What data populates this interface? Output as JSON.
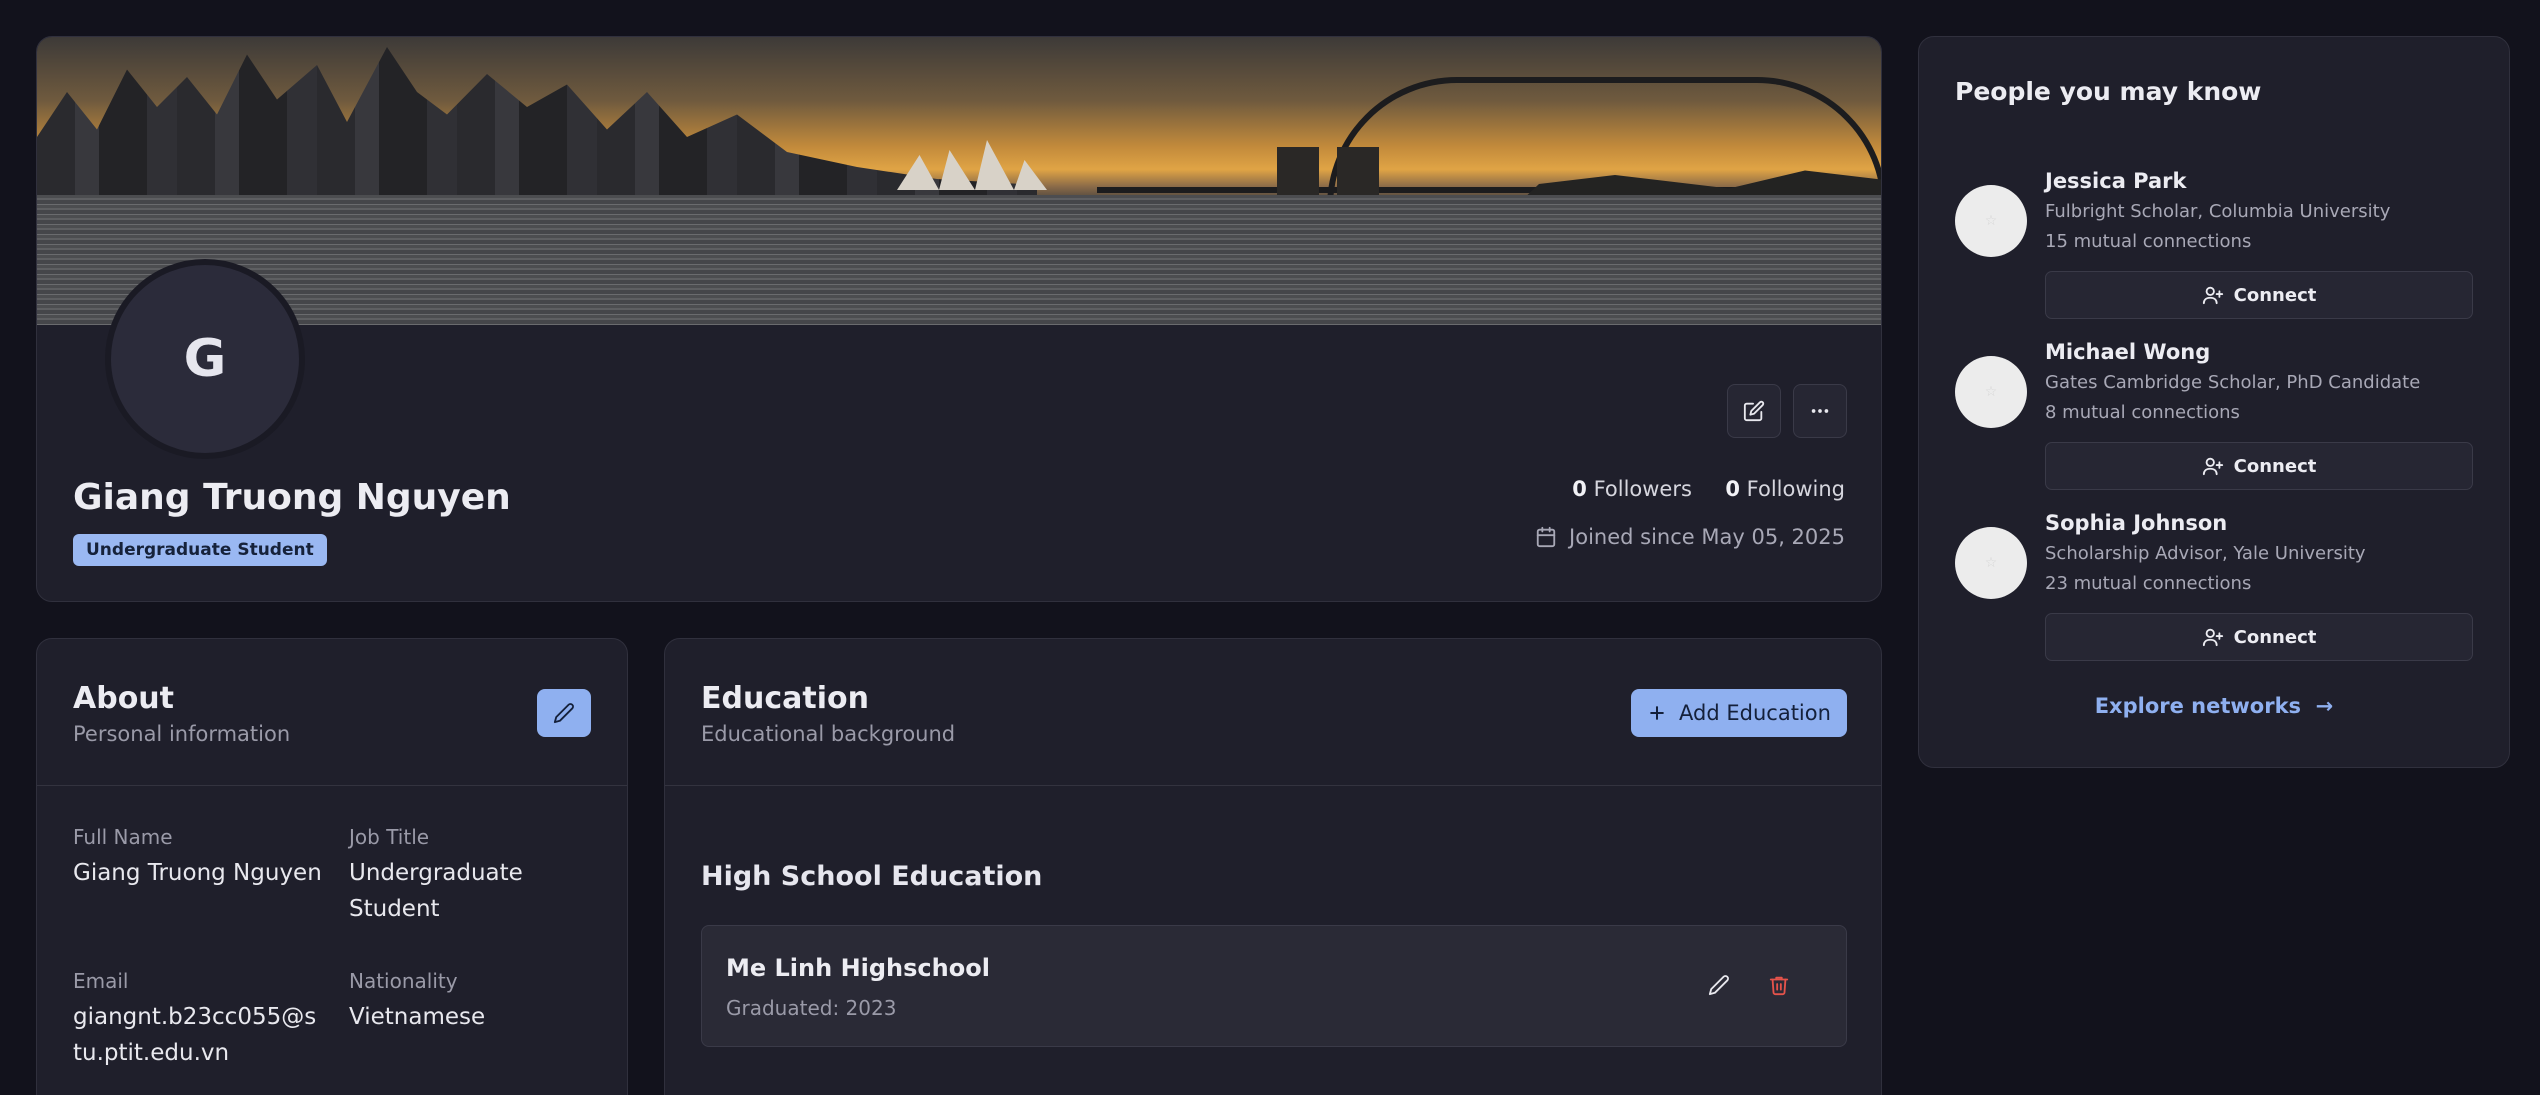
{
  "profile": {
    "avatar_initial": "G",
    "name": "Giang Truong Nguyen",
    "role_badge": "Undergraduate Student",
    "followers_count": "0",
    "followers_label": "Followers",
    "following_count": "0",
    "following_label": "Following",
    "joined": "Joined since May 05, 2025"
  },
  "about": {
    "title": "About",
    "subtitle": "Personal information",
    "fields": [
      {
        "label": "Full Name",
        "value": "Giang Truong Nguyen"
      },
      {
        "label": "Job Title",
        "value": "Undergraduate Student"
      },
      {
        "label": "Email",
        "value": "giangnt.b23cc055@stu.ptit.edu.vn"
      },
      {
        "label": "Nationality",
        "value": "Vietnamese"
      }
    ]
  },
  "education": {
    "title": "Education",
    "subtitle": "Educational background",
    "add_label": "Add Education",
    "section_title": "High School Education",
    "items": [
      {
        "name": "Me Linh Highschool",
        "graduated": "Graduated: 2023"
      }
    ]
  },
  "people": {
    "title": "People you may know",
    "connect_label": "Connect",
    "items": [
      {
        "name": "Jessica Park",
        "role": "Fulbright Scholar, Columbia University",
        "mutual": "15 mutual connections"
      },
      {
        "name": "Michael Wong",
        "role": "Gates Cambridge Scholar, PhD Candidate",
        "mutual": "8 mutual connections"
      },
      {
        "name": "Sophia Johnson",
        "role": "Scholarship Advisor, Yale University",
        "mutual": "23 mutual connections"
      }
    ],
    "explore_label": "Explore networks"
  },
  "colors": {
    "background": "#12121c",
    "card": "#1f1f2b",
    "accent": "#8fb0f0",
    "danger": "#e5534b"
  }
}
